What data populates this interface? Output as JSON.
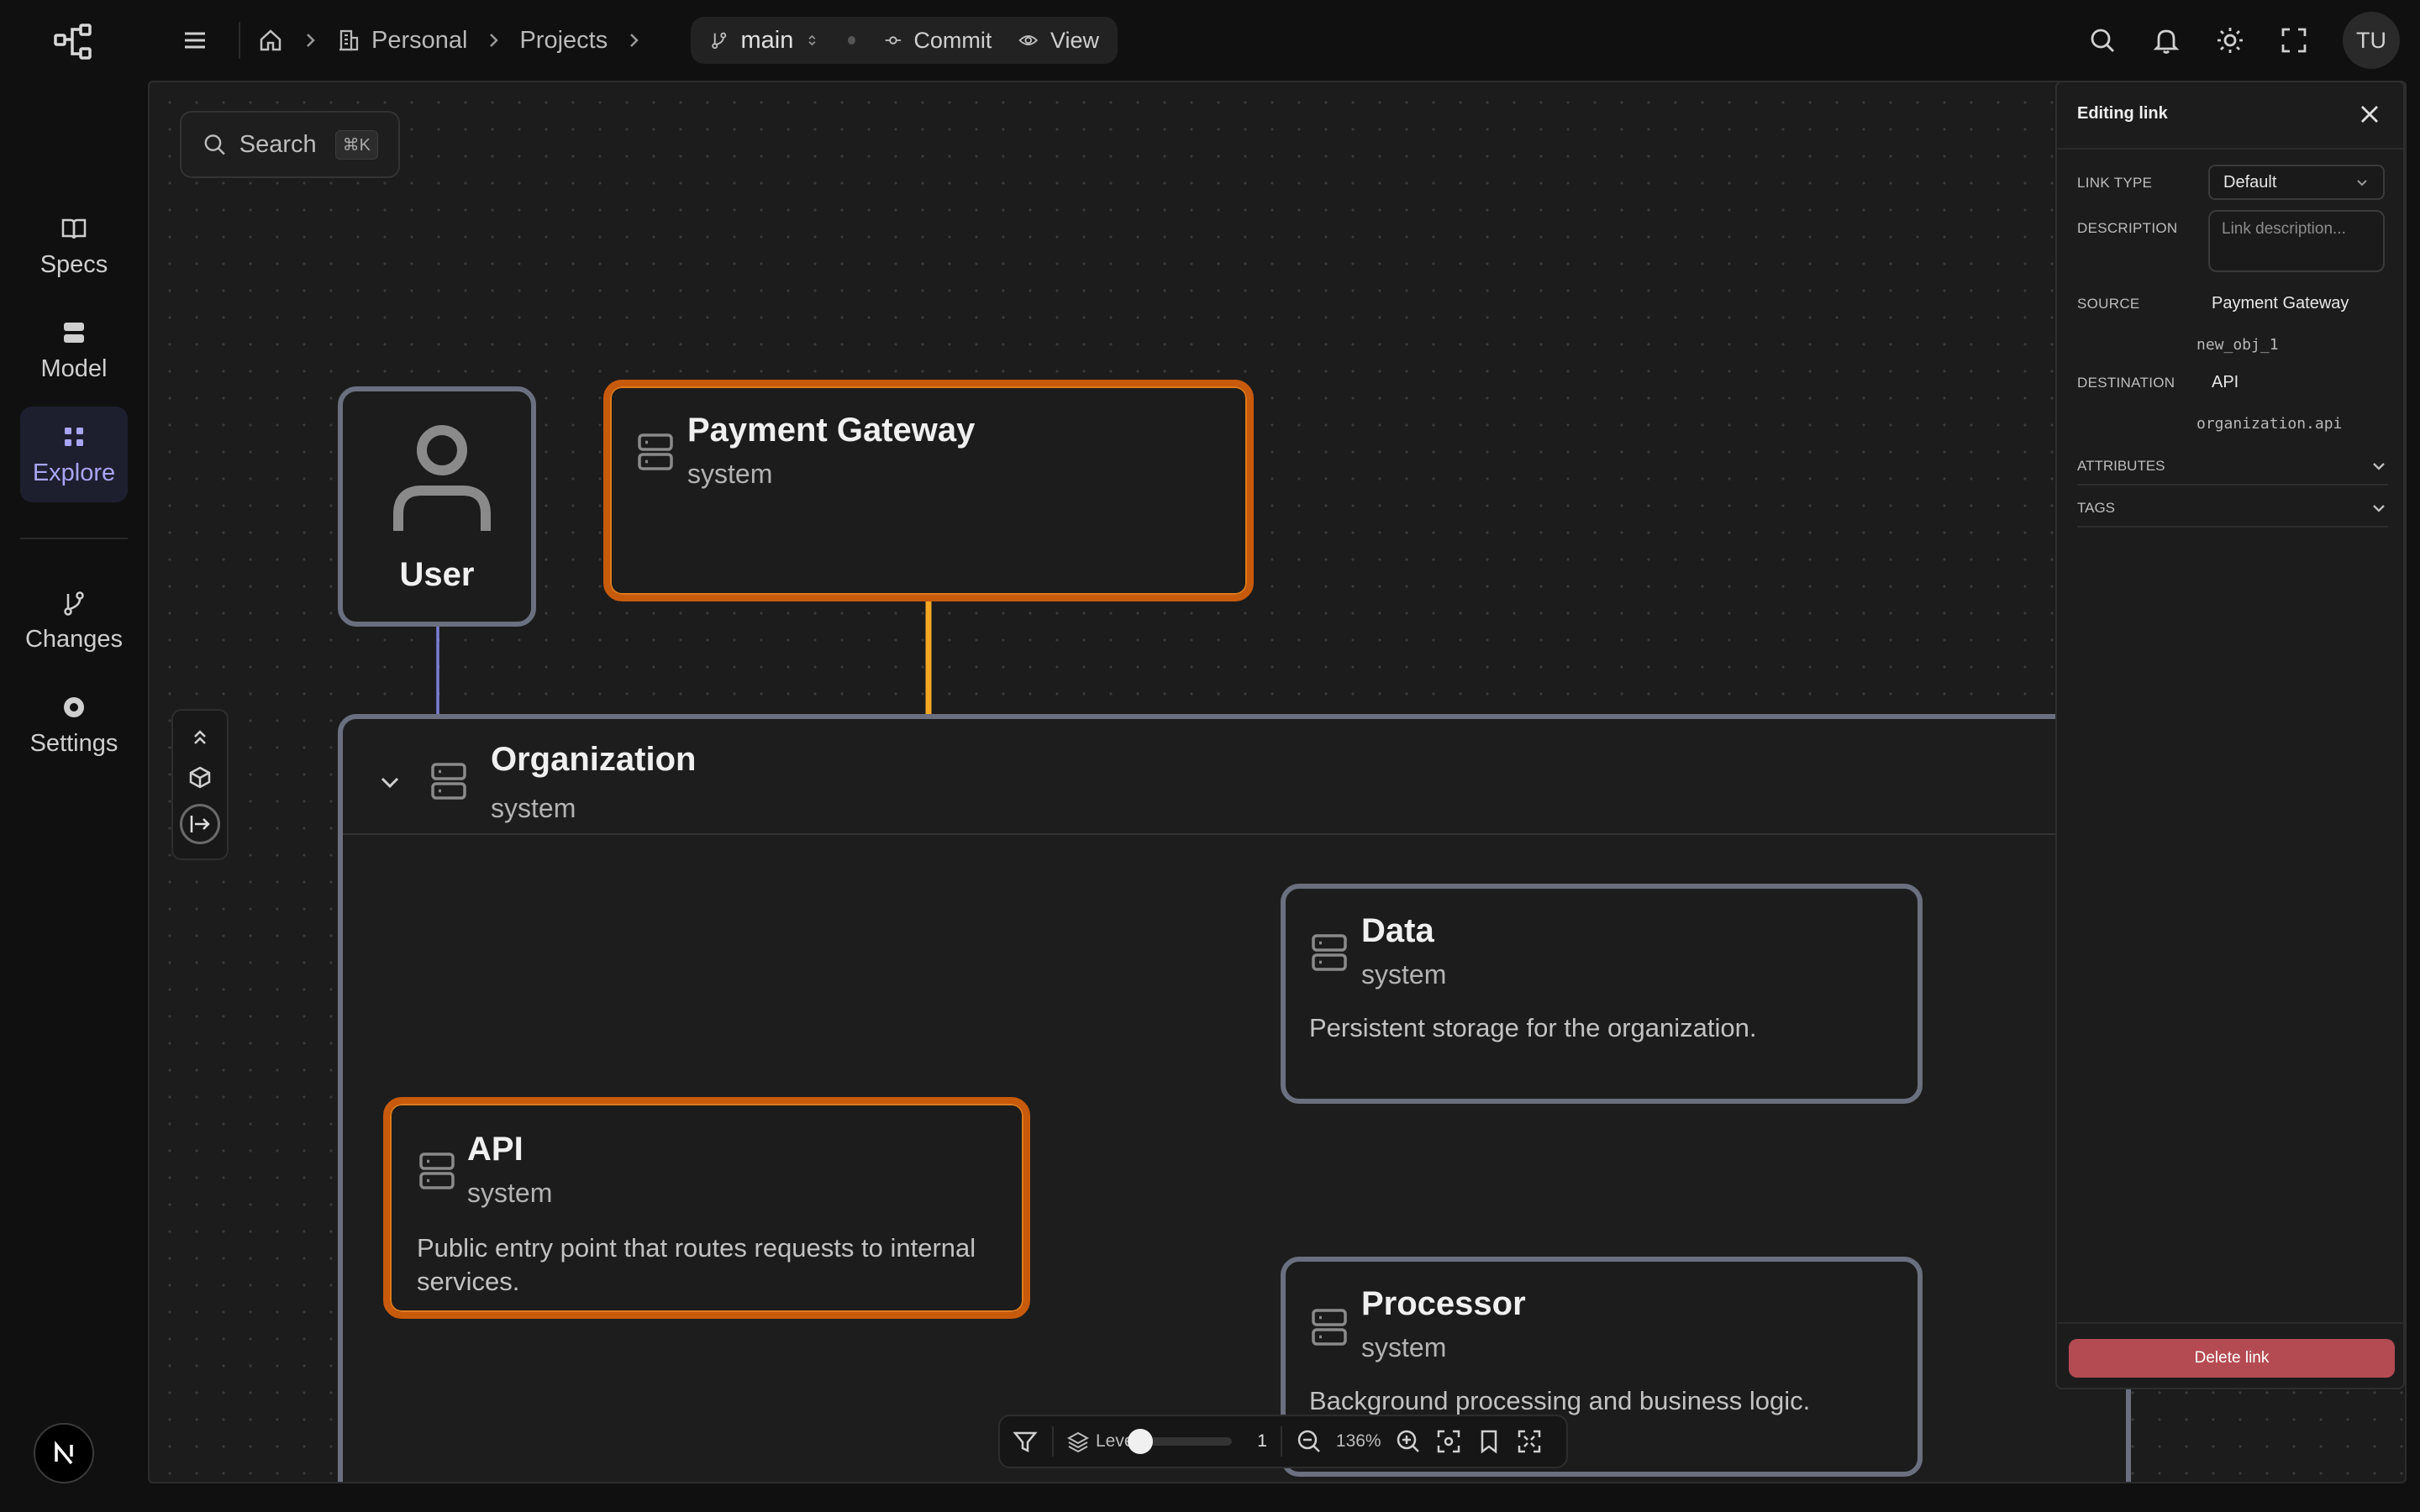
{
  "nav": {
    "items": [
      {
        "label": "Specs",
        "icon": "book-icon"
      },
      {
        "label": "Model",
        "icon": "model-icon"
      },
      {
        "label": "Explore",
        "icon": "grid-icon",
        "active": true
      },
      {
        "label": "Changes",
        "icon": "branch-icon"
      },
      {
        "label": "Settings",
        "icon": "gear-icon"
      }
    ],
    "badge": "N"
  },
  "topbar": {
    "breadcrumbs": [
      "Personal",
      "Projects"
    ],
    "branch": "main",
    "commit_label": "Commit",
    "view_label": "View",
    "avatar": "TU"
  },
  "canvas": {
    "search_placeholder": "Search",
    "search_shortcut": "⌘K",
    "nodes": {
      "user": {
        "title": "User"
      },
      "payment_gateway": {
        "title": "Payment Gateway",
        "type": "system"
      },
      "organization": {
        "title": "Organization",
        "type": "system"
      },
      "api": {
        "title": "API",
        "type": "system",
        "description": "Public entry point that routes requests to internal services."
      },
      "data": {
        "title": "Data",
        "type": "system",
        "description": "Persistent storage for the organization."
      },
      "processor": {
        "title": "Processor",
        "type": "system",
        "description": "Background processing and business logic."
      }
    },
    "toolbar": {
      "level_label": "Level",
      "level_value": "1",
      "zoom": "136%"
    }
  },
  "panel": {
    "title": "Editing link",
    "link_type_label": "LINK TYPE",
    "link_type_value": "Default",
    "description_label": "DESCRIPTION",
    "description_placeholder": "Link description...",
    "source_label": "SOURCE",
    "source_name": "Payment Gateway",
    "source_id": "new_obj_1",
    "destination_label": "DESTINATION",
    "destination_name": "API",
    "destination_id": "organization.api",
    "attributes_label": "ATTRIBUTES",
    "tags_label": "TAGS",
    "delete_label": "Delete link"
  },
  "colors": {
    "accent": "#a8a5f5",
    "selected_border": "#c85a0c",
    "selected_link": "#f5a623",
    "link": "#7b7fd6",
    "danger": "#b54b52"
  }
}
